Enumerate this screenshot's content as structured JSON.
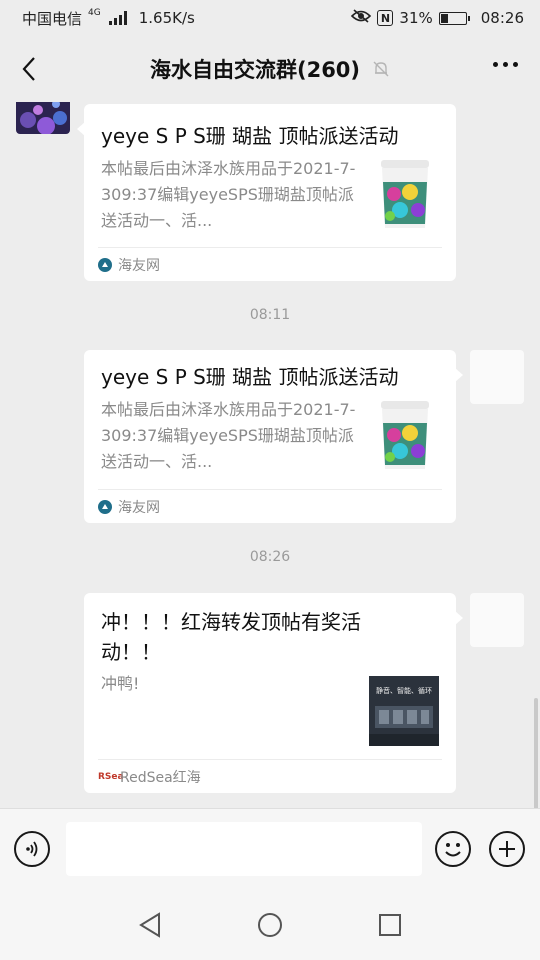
{
  "status": {
    "carrier": "中国电信",
    "network_type": "4G",
    "speed": "1.65K/s",
    "battery_percent": "31%",
    "battery_level": 0.31,
    "time": "08:26",
    "icons": [
      "eye-icon",
      "nfc-icon",
      "signal-icon",
      "battery-icon"
    ]
  },
  "header": {
    "title": "海水自由交流群(260)",
    "icons": [
      "back-icon",
      "mute-bell-icon",
      "more-icon"
    ]
  },
  "messages": [
    {
      "type": "link-card",
      "sender": "other",
      "title": "yeye S P S珊 瑚盐 顶帖派送活动",
      "desc": "本帖最后由沐泽水族用品于2021-7-309:37编辑yeyeSPS珊瑚盐顶帖派送活动一、活...",
      "source": "海友网",
      "thumb": "salt-bucket"
    },
    {
      "type": "timestamp",
      "text": "08:11"
    },
    {
      "type": "link-card",
      "sender": "self",
      "title": "yeye S P S珊 瑚盐 顶帖派送活动",
      "desc": "本帖最后由沐泽水族用品于2021-7-309:37编辑yeyeSPS珊瑚盐顶帖派送活动一、活...",
      "source": "海友网",
      "thumb": "salt-bucket"
    },
    {
      "type": "timestamp",
      "text": "08:26"
    },
    {
      "type": "link-card",
      "sender": "self",
      "title": "冲！！！红海转发顶帖有奖活动！！",
      "desc": "冲鸭!",
      "source": "RedSea红海",
      "source_logo": "RSea",
      "thumb": "aquarium-product",
      "thumb_text": "静音、智能、循环"
    }
  ],
  "input": {
    "placeholder": "",
    "value": ""
  },
  "input_bar_icons": [
    "voice-icon",
    "emoji-icon",
    "plus-icon"
  ],
  "nav": [
    "back-triangle-icon",
    "home-circle-icon",
    "recents-square-icon"
  ],
  "colors": {
    "background": "#ededed",
    "card": "#ffffff",
    "source_icon": "#1f6e8a",
    "redsea_logo": "#c0392b"
  }
}
